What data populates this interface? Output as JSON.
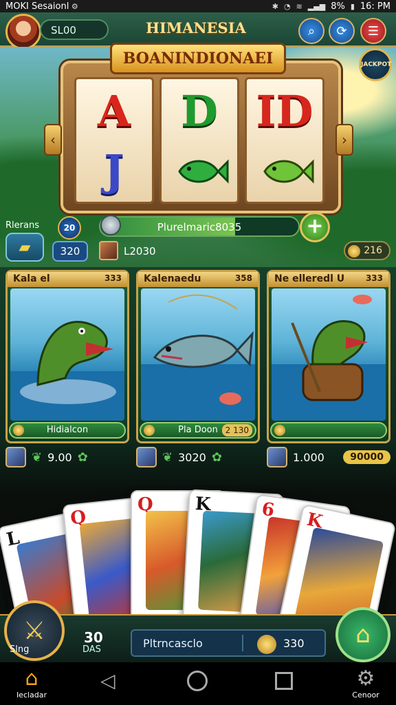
{
  "status_bar": {
    "left_text": "MOKI Sesaionl",
    "time": "16: PM",
    "battery": "8%"
  },
  "header": {
    "user": "SL00",
    "title": "HIMANESIA"
  },
  "slot": {
    "banner": "BOANINDIONAEI",
    "reels": [
      {
        "top": "A",
        "bottom": "J"
      },
      {
        "top": "D",
        "bottom": ""
      },
      {
        "top": "ID",
        "bottom": ""
      }
    ],
    "jackpot_badge": "JACKPOT"
  },
  "controls": {
    "level_label": "Rlerans",
    "level": "20",
    "progress_text": "Plurelmaric8035",
    "progress_fraction": 0.68,
    "bet": "320",
    "bet_value": "L2030",
    "gold": "216"
  },
  "game_cards": [
    {
      "title": "Kala el",
      "count": "333",
      "footer": "Hidialcon",
      "footer_value": ""
    },
    {
      "title": "Kalenaedu",
      "count": "358",
      "footer": "Pla Doon",
      "footer_value": "2 130"
    },
    {
      "title": "Ne elleredl U",
      "count": "333",
      "footer": "",
      "footer_value": ""
    }
  ],
  "card_stats": [
    {
      "value": "9.00",
      "pill": ""
    },
    {
      "value": "3020",
      "pill": ""
    },
    {
      "value": "1.000",
      "pill": "90000"
    }
  ],
  "playing_cards": [
    "L",
    "Q",
    "Q",
    "K",
    "6",
    "K"
  ],
  "bottom": {
    "spin_label": "Slng",
    "bet_big": "30",
    "bet_sub": "DAS",
    "info_text": "Pltrncasclo",
    "info_value": "330"
  },
  "navbar": {
    "home_label": "Iecladar",
    "settings_label": "Cenoor"
  }
}
